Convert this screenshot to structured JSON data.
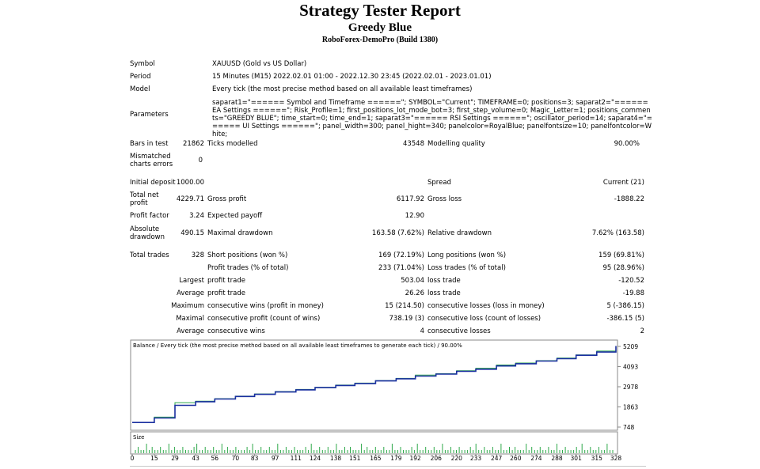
{
  "header": {
    "title": "Strategy Tester Report",
    "subtitle": "Greedy Blue",
    "build": "RoboForex-DemoPro (Build 1380)"
  },
  "info": {
    "symbol_label": "Symbol",
    "symbol_value": "XAUUSD (Gold vs US Dollar)",
    "period_label": "Period",
    "period_value": "15 Minutes (M15) 2022.02.01 01:00 - 2022.12.30 23:45 (2022.02.01 - 2023.01.01)",
    "model_label": "Model",
    "model_value": "Every tick (the most precise method based on all available least timeframes)",
    "parameters_label": "Parameters",
    "parameters_value": "saparat1=\"====== Symbol and Timeframe ======\"; SYMBOL=\"Current\"; TIMEFRAME=0; positions=3; saparat2=\"====== EA Settings ======\"; Risk_Profile=1; first_positions_lot_mode_bot=3; first_step_volume=0; Magic_Letter=1; positions_comments=\"GREEDY BLUE\"; time_start=0; time_end=1; saparat3=\"====== RSI Settings ======\"; oscillator_period=14; saparat4=\"====== UI Settings ======\"; panel_width=300; panel_hight=340; panelcolor=RoyalBlue; panelfontsize=10; panelfontcolor=White;"
  },
  "stats": {
    "bars_label": "Bars in test",
    "bars_value": "21862",
    "ticks_label": "Ticks modelled",
    "ticks_value": "43548",
    "quality_label": "Modelling quality",
    "quality_value": "90.00%",
    "mismatched_label_1": "Mismatched",
    "mismatched_label_2": "charts errors",
    "mismatched_value": "0",
    "deposit_label": "Initial deposit",
    "deposit_value": "1000.00",
    "spread_label": "Spread",
    "spread_value": "Current (21)",
    "netprofit_label_1": "Total net",
    "netprofit_label_2": "profit",
    "netprofit_value": "4229.71",
    "grossprofit_label": "Gross profit",
    "grossprofit_value": "6117.92",
    "grossloss_label": "Gross loss",
    "grossloss_value": "-1888.22",
    "pfactor_label": "Profit factor",
    "pfactor_value": "3.24",
    "payoff_label": "Expected payoff",
    "payoff_value": "12.90",
    "absdd_label_1": "Absolute",
    "absdd_label_2": "drawdown",
    "absdd_value": "490.15",
    "maxdd_label": "Maximal drawdown",
    "maxdd_value": "163.58 (7.62%)",
    "reldd_label": "Relative drawdown",
    "reldd_value": "7.62% (163.58)",
    "trades_label": "Total trades",
    "trades_value": "328",
    "short_label": "Short positions (won %)",
    "short_value": "169 (72.19%)",
    "long_label": "Long positions (won %)",
    "long_value": "159 (69.81%)",
    "profittrades_label": "Profit trades (% of total)",
    "profittrades_value": "233 (71.04%)",
    "losstrades_label": "Loss trades (% of total)",
    "losstrades_value": "95 (28.96%)",
    "largest_label": "Largest",
    "largest_profit_label": "profit trade",
    "largest_profit_value": "503.04",
    "largest_loss_label": "loss trade",
    "largest_loss_value": "-120.52",
    "average_label": "Average",
    "average_profit_label": "profit trade",
    "average_profit_value": "26.26",
    "average_loss_label": "loss trade",
    "average_loss_value": "-19.88",
    "maximum_label": "Maximum",
    "max_wins_label": "consecutive wins (profit in money)",
    "max_wins_value": "15 (214.50)",
    "max_losses_label": "consecutive losses (loss in money)",
    "max_losses_value": "5 (-386.15)",
    "maximal_label": "Maximal",
    "maximal_profit_label": "consecutive profit (count of wins)",
    "maximal_profit_value": "738.19 (3)",
    "maximal_loss_label": "consecutive loss (count of losses)",
    "maximal_loss_value": "-386.15 (5)",
    "average2_label": "Average",
    "avg_wins_label": "consecutive wins",
    "avg_wins_value": "4",
    "avg_losses_label": "consecutive losses",
    "avg_losses_value": "2"
  },
  "colors": {
    "balance": "#1a2fa0",
    "equity": "#2ea84a",
    "size": "#2ea84a",
    "border": "#8a8a8a"
  },
  "chart_data": {
    "type": "line",
    "title": "Balance / Every tick (the most precise method based on all available least timeframes to generate each tick) / 90.00%",
    "yticks": [
      "5209",
      "4093",
      "2978",
      "1863",
      "748"
    ],
    "ylim": [
      748,
      5209
    ],
    "xlim": [
      0,
      328
    ],
    "x": [
      0,
      15,
      29,
      43,
      56,
      70,
      83,
      97,
      111,
      124,
      138,
      151,
      165,
      179,
      192,
      206,
      220,
      233,
      247,
      260,
      274,
      288,
      301,
      315,
      328
    ],
    "xticks": [
      "0",
      "15",
      "29",
      "43",
      "56",
      "70",
      "83",
      "97",
      "111",
      "124",
      "138",
      "151",
      "165",
      "179",
      "192",
      "206",
      "220",
      "233",
      "247",
      "260",
      "274",
      "288",
      "301",
      "315",
      "328"
    ],
    "series": [
      {
        "values": [
          1000,
          1250,
          1950,
          2150,
          2300,
          2440,
          2560,
          2690,
          2810,
          2930,
          3050,
          3160,
          3300,
          3420,
          3570,
          3680,
          3830,
          3950,
          4130,
          4250,
          4400,
          4530,
          4720,
          4900,
          5229
        ]
      },
      {
        "values": [
          1000,
          1300,
          2100,
          2180,
          2320,
          2460,
          2580,
          2710,
          2830,
          2950,
          3070,
          3180,
          3320,
          3440,
          3620,
          3700,
          3860,
          4000,
          4180,
          4290,
          4420,
          4560,
          4740,
          4950,
          5229
        ]
      }
    ],
    "size_label": "Size",
    "size_values": [
      1,
      2,
      1,
      1,
      3,
      1,
      2,
      1,
      1,
      2,
      1,
      1,
      3,
      1,
      2,
      1,
      1,
      2,
      1,
      1,
      1,
      2,
      3,
      1,
      1,
      2,
      1,
      1,
      2,
      1,
      1,
      3,
      1,
      2,
      1,
      1,
      2,
      1,
      1,
      1,
      2,
      1,
      3,
      1,
      1,
      2,
      1,
      1,
      2,
      1,
      1,
      3,
      1,
      1,
      2,
      1,
      1,
      2,
      1,
      1,
      1,
      2,
      1,
      3,
      1,
      1,
      2,
      1,
      1,
      2,
      1,
      1,
      3,
      1,
      1,
      2,
      1,
      2,
      1,
      1,
      1,
      3,
      1,
      2,
      1,
      1,
      2,
      1,
      1,
      2,
      1,
      1,
      3,
      1,
      1,
      2,
      1,
      1,
      1,
      2,
      1,
      3,
      1,
      1,
      2,
      1,
      1,
      2,
      1,
      1,
      3,
      1,
      1,
      2,
      1,
      1,
      2,
      1,
      1,
      1,
      2,
      1,
      3,
      1,
      1,
      2,
      1,
      1,
      2,
      1,
      1,
      3,
      1,
      1,
      2,
      1,
      2,
      1,
      1,
      1,
      3,
      1,
      2,
      1,
      1,
      2,
      1,
      1,
      2,
      1,
      1,
      3,
      1,
      1,
      2,
      1,
      1,
      1,
      2,
      1,
      3,
      1,
      1,
      2,
      1,
      1,
      2,
      1,
      1,
      3,
      1,
      1
    ]
  }
}
